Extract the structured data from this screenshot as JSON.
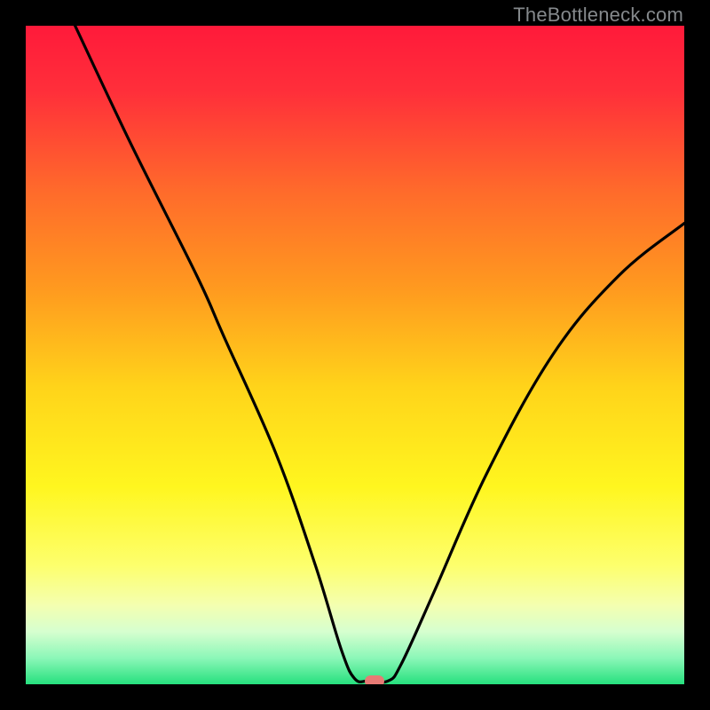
{
  "watermark": "TheBottleneck.com",
  "colors": {
    "black": "#000000",
    "gradient_stops": [
      {
        "offset": 0.0,
        "color": "#ff1a3a"
      },
      {
        "offset": 0.1,
        "color": "#ff2f3a"
      },
      {
        "offset": 0.25,
        "color": "#ff6a2b"
      },
      {
        "offset": 0.4,
        "color": "#ff9a1f"
      },
      {
        "offset": 0.55,
        "color": "#ffd41a"
      },
      {
        "offset": 0.7,
        "color": "#fff61f"
      },
      {
        "offset": 0.82,
        "color": "#fdff6d"
      },
      {
        "offset": 0.88,
        "color": "#f4ffb0"
      },
      {
        "offset": 0.92,
        "color": "#d6ffcf"
      },
      {
        "offset": 0.96,
        "color": "#8cf7b8"
      },
      {
        "offset": 1.0,
        "color": "#26e07e"
      }
    ],
    "marker": "#e77a74",
    "curve": "#000000"
  },
  "chart_data": {
    "type": "line",
    "title": "",
    "xlabel": "",
    "ylabel": "",
    "xlim": [
      0,
      100
    ],
    "ylim": [
      0,
      100
    ],
    "marker": {
      "x": 53,
      "y": 0
    },
    "series": [
      {
        "name": "bottleneck-curve",
        "points": [
          {
            "x": 7.5,
            "y": 100
          },
          {
            "x": 16,
            "y": 82
          },
          {
            "x": 26,
            "y": 62
          },
          {
            "x": 30,
            "y": 53
          },
          {
            "x": 38,
            "y": 35
          },
          {
            "x": 44,
            "y": 18
          },
          {
            "x": 48,
            "y": 5
          },
          {
            "x": 50,
            "y": 0.8
          },
          {
            "x": 52,
            "y": 0.5
          },
          {
            "x": 55,
            "y": 0.5
          },
          {
            "x": 57,
            "y": 3
          },
          {
            "x": 62,
            "y": 14
          },
          {
            "x": 70,
            "y": 32
          },
          {
            "x": 80,
            "y": 50
          },
          {
            "x": 90,
            "y": 62
          },
          {
            "x": 100,
            "y": 70
          }
        ]
      }
    ]
  }
}
